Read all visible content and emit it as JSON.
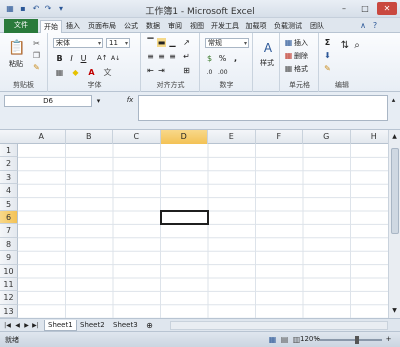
{
  "window": {
    "title": "工作簿1 - Microsoft Excel",
    "minimize_glyph": "–",
    "maximize_glyph": "□",
    "close_glyph": "✕"
  },
  "quick_access": [
    "save-icon",
    "undo-icon",
    "redo-icon"
  ],
  "tabs": {
    "file": "文件",
    "items": [
      "开始",
      "插入",
      "页面布局",
      "公式",
      "数据",
      "审阅",
      "视图",
      "开发工具",
      "加载项",
      "负载测试",
      "团队"
    ]
  },
  "ribbon": {
    "clipboard": {
      "paste": "粘贴",
      "label": "剪贴板"
    },
    "font": {
      "name": "宋体",
      "size": "11",
      "bold": "B",
      "italic": "I",
      "underline": "U",
      "font_color_glyph": "A",
      "label": "字体"
    },
    "alignment": {
      "label": "对齐方式"
    },
    "number": {
      "format": "常规",
      "percent": "%",
      "comma": ",",
      "label": "数字"
    },
    "styles": {
      "big_label": "样式",
      "glyph": "A"
    },
    "cells": {
      "insert": "插入",
      "delete": "删除",
      "format": "格式",
      "label": "单元格"
    },
    "editing": {
      "sum": "Σ",
      "label": "编辑"
    }
  },
  "formula_bar": {
    "name_box": "D6",
    "fx": "fx",
    "value": ""
  },
  "grid": {
    "columns": [
      "A",
      "B",
      "C",
      "D",
      "E",
      "F",
      "G",
      "H"
    ],
    "rows": [
      "1",
      "2",
      "3",
      "4",
      "5",
      "6",
      "7",
      "8",
      "9",
      "10",
      "11",
      "12",
      "13"
    ],
    "selected_column": "D",
    "selected_row": "6"
  },
  "sheets": [
    "Sheet1",
    "Sheet2",
    "Sheet3"
  ],
  "status": {
    "ready": "就绪",
    "zoom": "120%"
  },
  "colors": {
    "file_tab": "#2a7a3b",
    "selection_header": "#f3c255",
    "close_button": "#c9483f"
  }
}
